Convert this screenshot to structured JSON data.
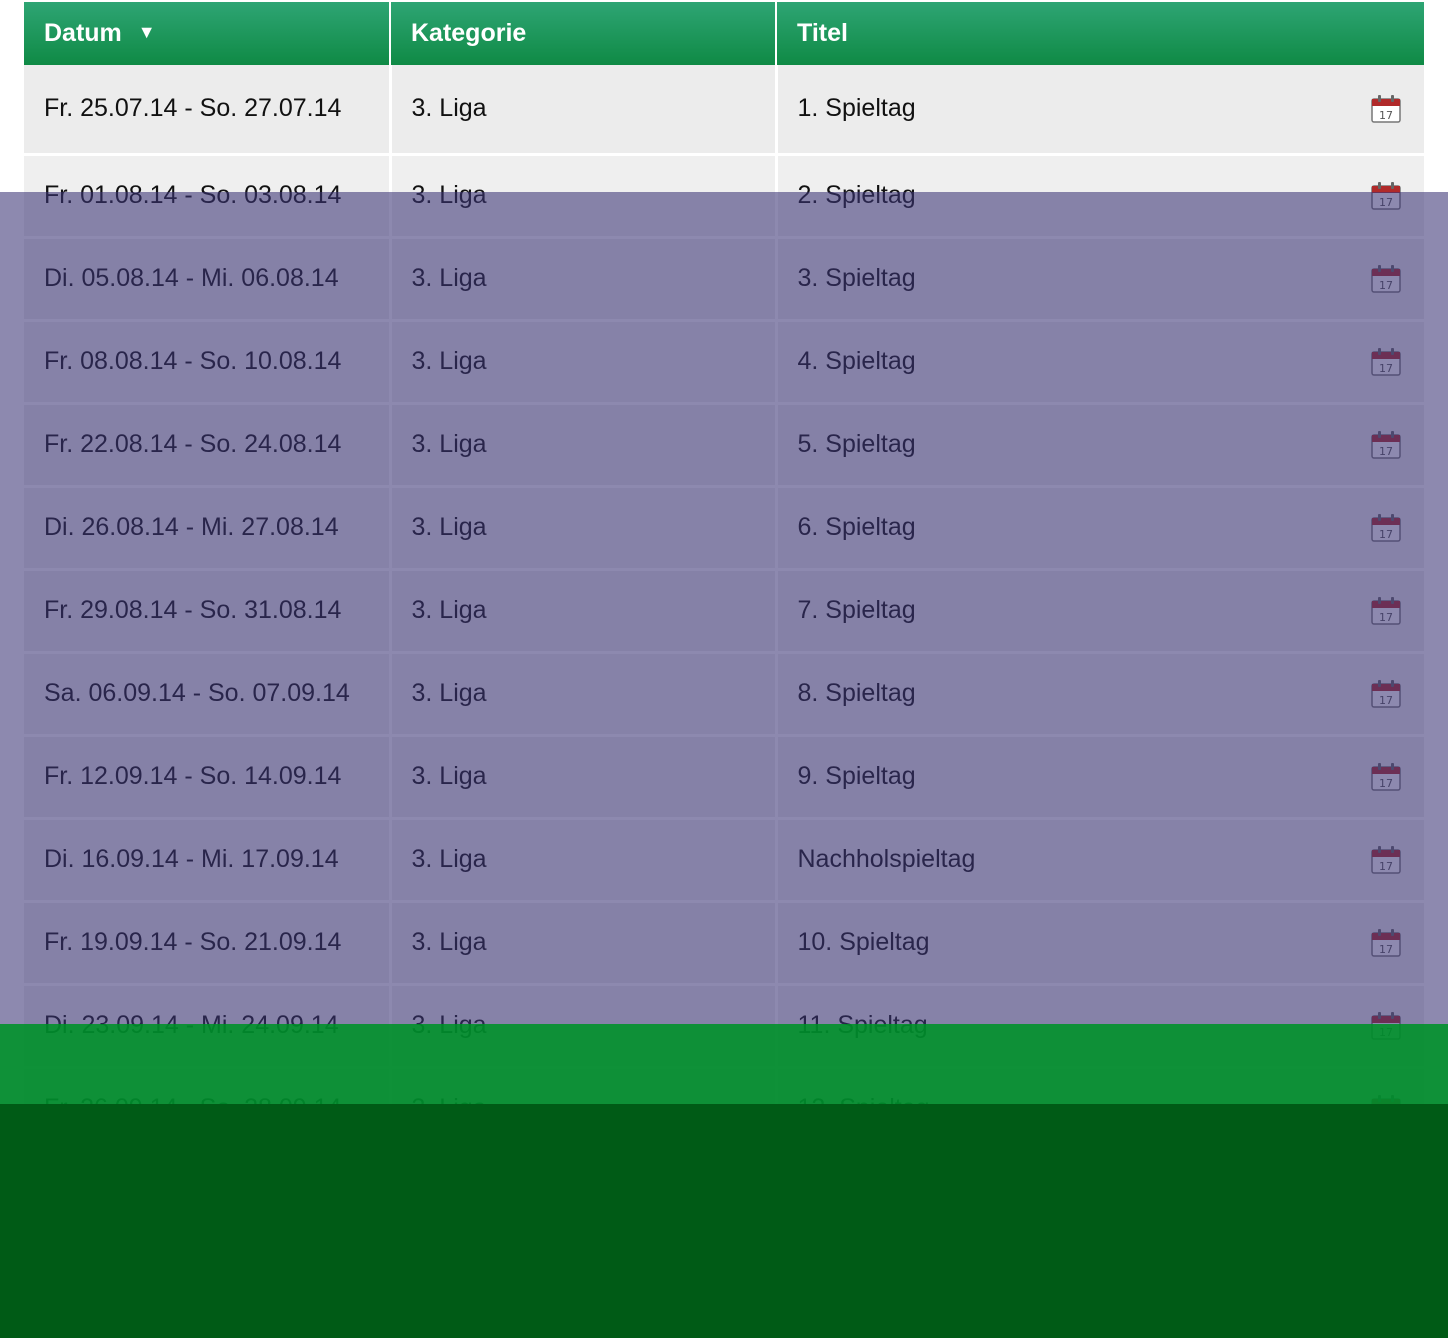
{
  "table": {
    "headers": {
      "date": "Datum",
      "sort_indicator": "▼",
      "category": "Kategorie",
      "title": "Titel"
    },
    "rows": [
      {
        "date": "Fr. 25.07.14 - So. 27.07.14",
        "category": "3. Liga",
        "title": "1. Spieltag",
        "icon": "calendar-icon"
      },
      {
        "date": "Fr. 01.08.14 - So. 03.08.14",
        "category": "3. Liga",
        "title": "2. Spieltag",
        "icon": "calendar-icon"
      },
      {
        "date": "Di. 05.08.14 - Mi. 06.08.14",
        "category": "3. Liga",
        "title": "3. Spieltag",
        "icon": "calendar-icon"
      },
      {
        "date": "Fr. 08.08.14 - So. 10.08.14",
        "category": "3. Liga",
        "title": "4. Spieltag",
        "icon": "calendar-icon"
      },
      {
        "date": "Fr. 22.08.14 - So. 24.08.14",
        "category": "3. Liga",
        "title": "5. Spieltag",
        "icon": "calendar-icon"
      },
      {
        "date": "Di. 26.08.14 - Mi. 27.08.14",
        "category": "3. Liga",
        "title": "6. Spieltag",
        "icon": "calendar-icon"
      },
      {
        "date": "Fr. 29.08.14 - So. 31.08.14",
        "category": "3. Liga",
        "title": "7. Spieltag",
        "icon": "calendar-icon"
      },
      {
        "date": "Sa. 06.09.14 - So. 07.09.14",
        "category": "3. Liga",
        "title": "8. Spieltag",
        "icon": "calendar-icon"
      },
      {
        "date": "Fr. 12.09.14 - So. 14.09.14",
        "category": "3. Liga",
        "title": "9. Spieltag",
        "icon": "calendar-icon"
      },
      {
        "date": "Di. 16.09.14 - Mi. 17.09.14",
        "category": "3. Liga",
        "title": "Nachholspieltag",
        "icon": "calendar-icon"
      },
      {
        "date": "Fr. 19.09.14 - So. 21.09.14",
        "category": "3. Liga",
        "title": "10. Spieltag",
        "icon": "calendar-icon"
      },
      {
        "date": "Di. 23.09.14 - Mi. 24.09.14",
        "category": "3. Liga",
        "title": "11. Spieltag",
        "icon": "calendar-icon"
      },
      {
        "date": "Fr. 26.09.14 - So. 28.09.14",
        "category": "3. Liga",
        "title": "12. Spieltag",
        "icon": "calendar-icon"
      },
      {
        "date": "",
        "category": "",
        "title": "",
        "icon": "calendar-icon"
      },
      {
        "date": "",
        "category": "",
        "title": "",
        "icon": "calendar-icon"
      }
    ]
  },
  "colors": {
    "header_green": "#1a9655",
    "row_background": "#ececec",
    "overlay_purple": "#3a3476",
    "overlay_green": "#008a2c",
    "overlay_dark_green": "#005b16",
    "calendar_red": "#b02a2a"
  }
}
